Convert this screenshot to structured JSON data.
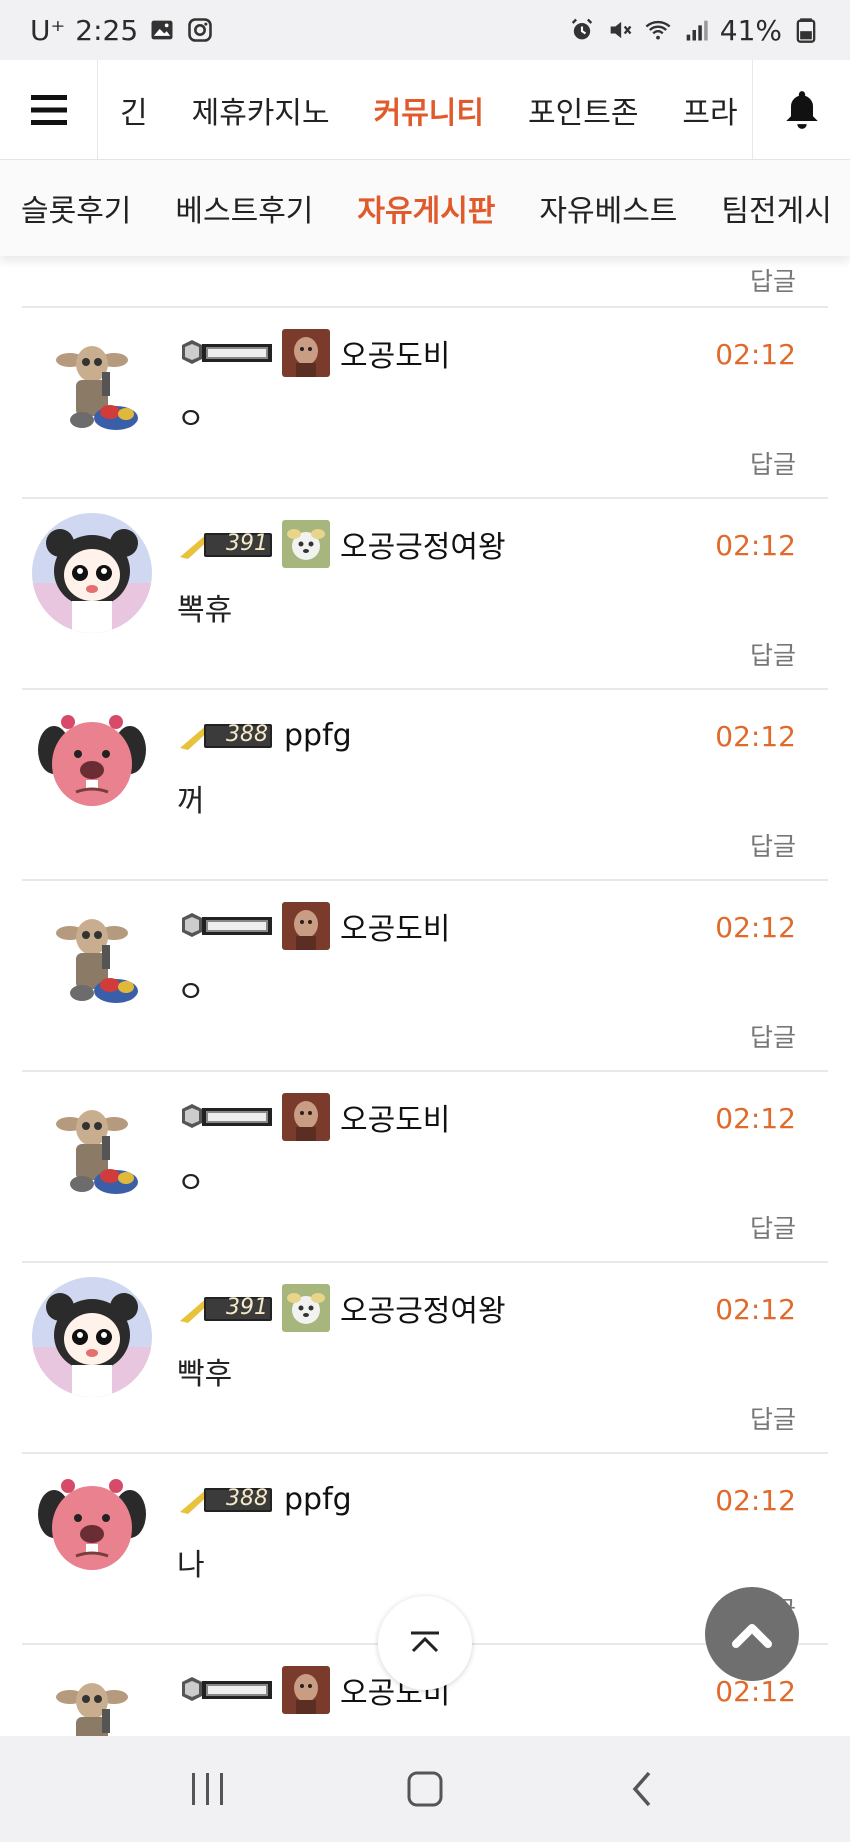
{
  "status": {
    "carrier": "U⁺",
    "time": "2:25",
    "battery": "41%"
  },
  "topnav": {
    "items": [
      "긴",
      "제휴카지노",
      "커뮤니티",
      "포인트존",
      "프라"
    ],
    "active_index": 2
  },
  "subnav": {
    "items": [
      "슬롯후기",
      "베스트후기",
      "자유게시판",
      "자유베스트",
      "팀전게시"
    ],
    "active_index": 2
  },
  "reply_label": "답글",
  "comments": [
    {
      "user": "오공도비",
      "level": "",
      "time": "02:12",
      "text": "ㅇ",
      "avatar": "dobby"
    },
    {
      "user": "오공긍정여왕",
      "level": "391",
      "time": "02:12",
      "text": "뽁휴",
      "avatar": "girl"
    },
    {
      "user": "ppfg",
      "level": "388",
      "time": "02:12",
      "text": "꺼",
      "avatar": "pink"
    },
    {
      "user": "오공도비",
      "level": "",
      "time": "02:12",
      "text": "ㅇ",
      "avatar": "dobby"
    },
    {
      "user": "오공도비",
      "level": "",
      "time": "02:12",
      "text": "ㅇ",
      "avatar": "dobby"
    },
    {
      "user": "오공긍정여왕",
      "level": "391",
      "time": "02:12",
      "text": "빡후",
      "avatar": "girl"
    },
    {
      "user": "ppfg",
      "level": "388",
      "time": "02:12",
      "text": "나",
      "avatar": "pink"
    },
    {
      "user": "오공도비",
      "level": "",
      "time": "02:12",
      "text": "",
      "avatar": "dobby"
    }
  ],
  "colors": {
    "accent": "#e05a2b",
    "time": "#e06a2b",
    "fab": "#6f6f6f"
  }
}
